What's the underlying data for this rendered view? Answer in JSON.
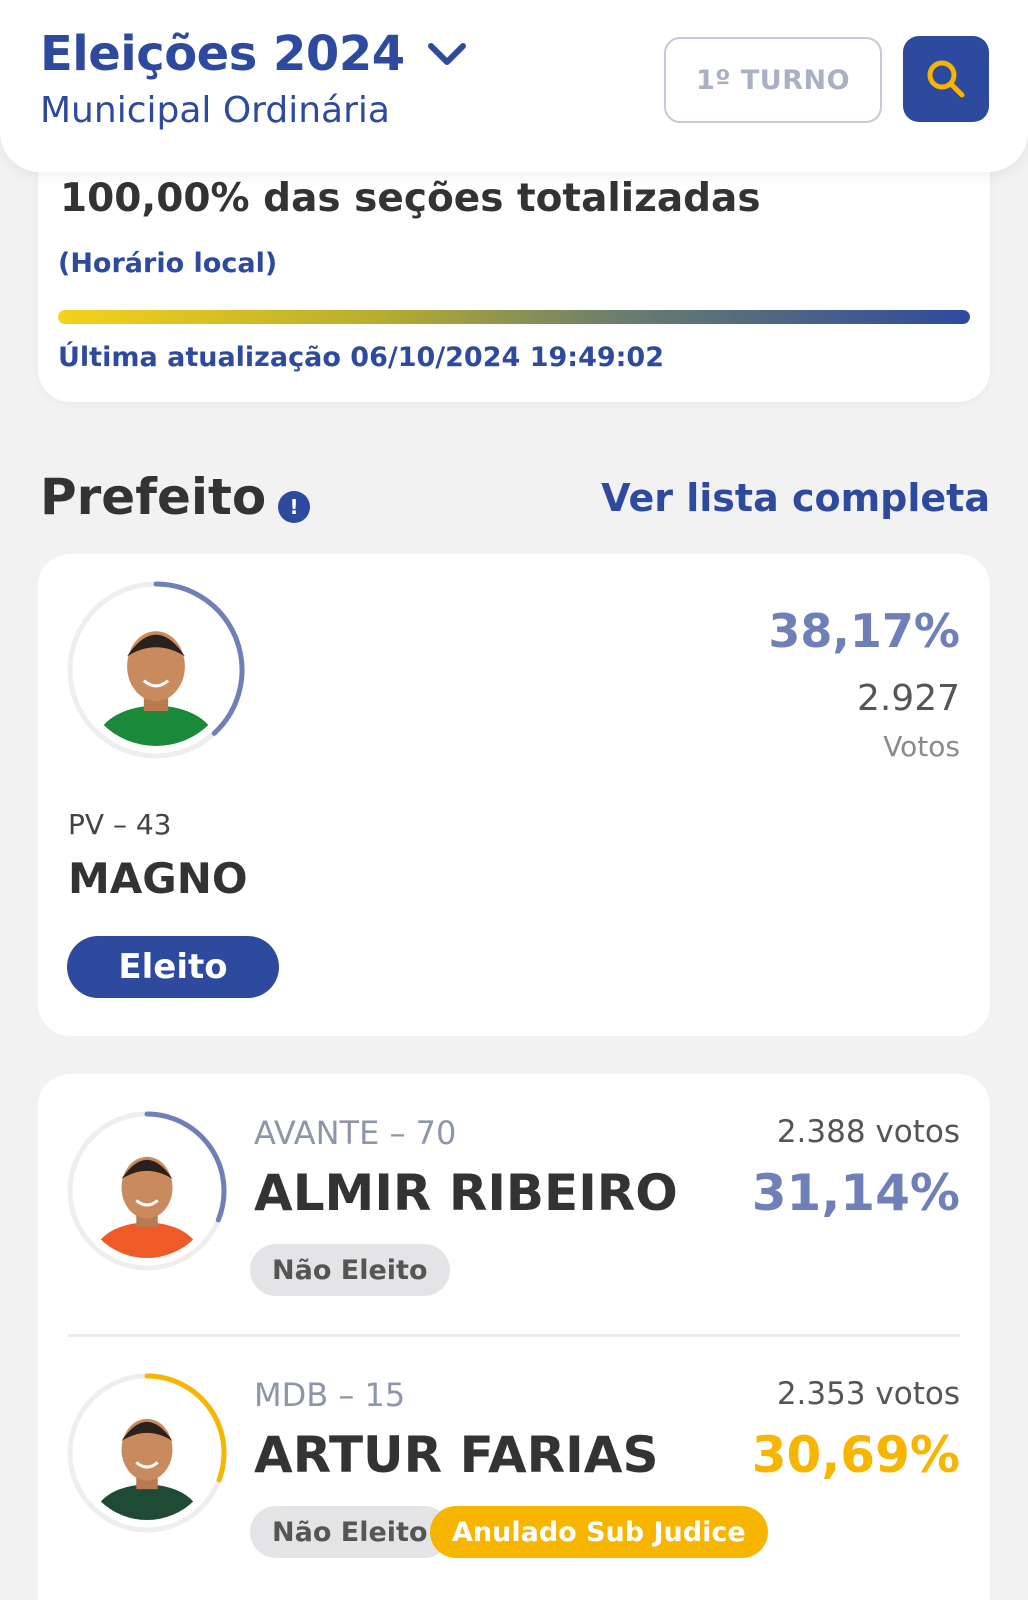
{
  "header": {
    "title": "Eleições 2024",
    "subtitle": "Municipal Ordinária",
    "turn_label": "1º TURNO"
  },
  "progress": {
    "totalized_text": "100,00% das seções totalizadas",
    "percent": 100,
    "local_time_label": "(Horário local)",
    "last_update": "Última atualização 06/10/2024 19:49:02"
  },
  "section": {
    "title": "Prefeito",
    "full_list_link": "Ver lista completa"
  },
  "winner": {
    "party": "PV – 43",
    "name": "MAGNO",
    "percent": "38,17%",
    "votes": "2.927",
    "votes_label": "Votos",
    "status": "Eleito",
    "ring_fraction": 0.3817,
    "ring_color": "#6f7fb7",
    "shirt_color": "#1a8a3a"
  },
  "candidates": [
    {
      "party": "AVANTE – 70",
      "name": "ALMIR RIBEIRO",
      "votes": "2.388 votos",
      "percent": "31,14%",
      "status": "Não Eleito",
      "ring_fraction": 0.3114,
      "ring_color": "#6f7fb7",
      "pct_color": "#6f7fb7",
      "shirt_color": "#f05a28"
    },
    {
      "party": "MDB – 15",
      "name": "ARTUR FARIAS",
      "votes": "2.353 votos",
      "percent": "30,69%",
      "status": "Não Eleito",
      "extra_status": "Anulado Sub Judice",
      "ring_fraction": 0.3069,
      "ring_color": "#f7b500",
      "pct_color": "#f7b500",
      "shirt_color": "#1f4a34"
    }
  ],
  "colors": {
    "primary": "#2e4a9e",
    "accent_yellow": "#f7b500",
    "background": "#f2f2f3"
  }
}
